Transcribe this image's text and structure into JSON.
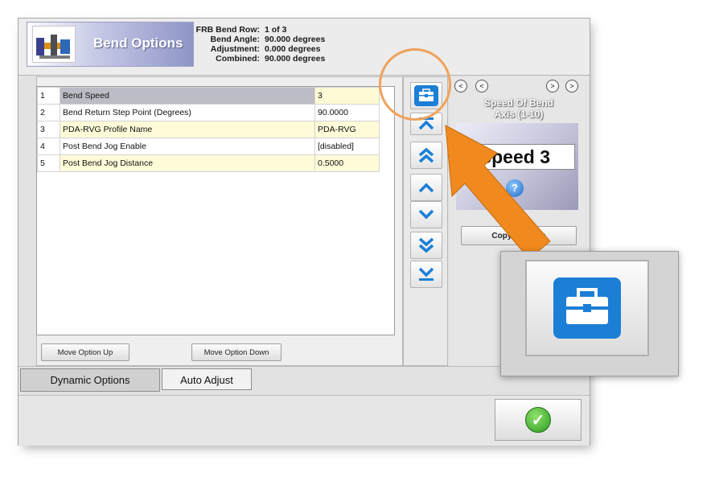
{
  "header": {
    "title": "Bend Options",
    "info": [
      {
        "label": "FRB Bend Row:",
        "value": "1 of 3"
      },
      {
        "label": "Bend Angle:",
        "value": "90.000 degrees"
      },
      {
        "label": "Adjustment:",
        "value": "0.000 degrees"
      },
      {
        "label": "Combined:",
        "value": "90.000 degrees"
      }
    ]
  },
  "table": {
    "rows": [
      {
        "num": "1",
        "name": "Bend Speed",
        "value": "3"
      },
      {
        "num": "2",
        "name": "Bend Return Step Point (Degrees)",
        "value": "90.0000"
      },
      {
        "num": "3",
        "name": "PDA-RVG Profile Name",
        "value": "PDA-RVG"
      },
      {
        "num": "4",
        "name": "Post Bend Jog Enable",
        "value": "[disabled]"
      },
      {
        "num": "5",
        "name": "Post Bend Jog Distance",
        "value": "0.5000"
      }
    ]
  },
  "buttons": {
    "move_up": "Move Option Up",
    "move_down": "Move Option Down",
    "copy_values": "Copy Val       lows"
  },
  "right_panel": {
    "nav_first": "<",
    "nav_prev": "<",
    "nav_next": ">",
    "nav_last": ">",
    "title_line1": "Speed Of Bend",
    "title_line2": "Axis (1-10)",
    "speed_display": "Speed 3",
    "help_symbol": "?"
  },
  "tabs": [
    {
      "label": "Dynamic Options"
    },
    {
      "label": "Auto Adjust"
    }
  ],
  "icons": {
    "toolbox": "toolbox-icon",
    "top": "move-to-top-icon",
    "page_up": "double-chevron-up-icon",
    "up": "chevron-up-icon",
    "down": "chevron-down-icon",
    "page_down": "double-chevron-down-icon",
    "bottom": "move-to-bottom-icon",
    "ok": "checkmark-icon"
  },
  "colors": {
    "accent_blue": "#1b7fd6",
    "highlight_orange": "#f0a25a",
    "arrow_orange": "#f08a1e",
    "ok_green": "#2d9a21"
  }
}
